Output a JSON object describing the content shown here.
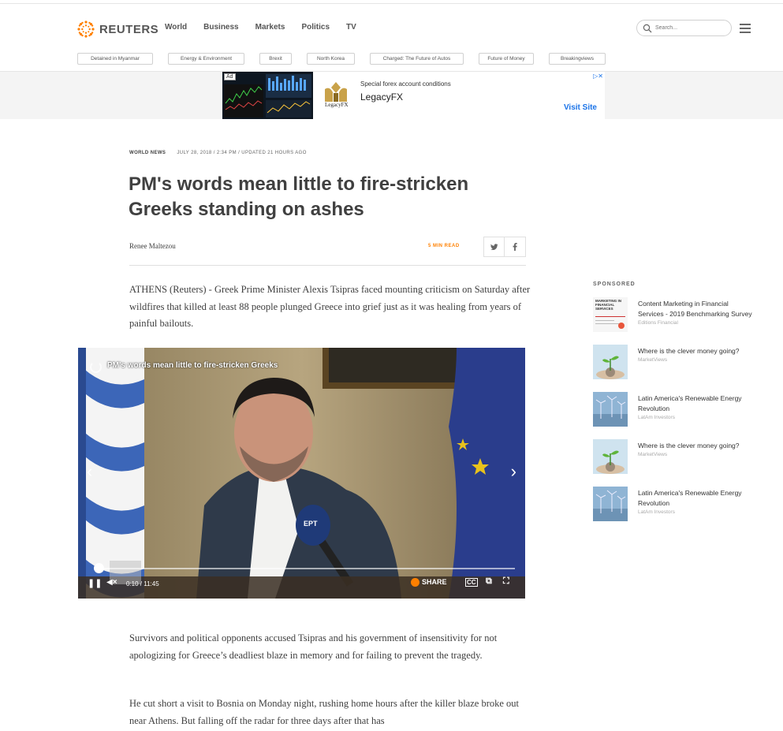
{
  "header": {
    "logo_text": "REUTERS",
    "nav": [
      "World",
      "Business",
      "Markets",
      "Politics",
      "TV"
    ],
    "search_placeholder": "Search...",
    "tags": [
      "Detained in Myanmar",
      "Energy & Environment",
      "Brexit",
      "North Korea",
      "Charged: The Future of Autos",
      "Future of Money",
      "Breakingviews"
    ]
  },
  "ad": {
    "label": "Ad",
    "tagline": "Special forex account conditions",
    "brand": "LegacyFX",
    "logo_text": "LegacyFX",
    "cta": "Visit Site",
    "close": "▷✕"
  },
  "article": {
    "category": "WORLD NEWS",
    "dateline": "JULY 28, 2018 / 2:34 PM / UPDATED 21 HOURS AGO",
    "headline": "PM's words mean little to fire-stricken Greeks standing on ashes",
    "author": "Renee Maltezou",
    "read_time": "5 MIN READ",
    "paragraphs": [
      "ATHENS (Reuters) - Greek Prime Minister Alexis Tsipras faced mounting criticism on Saturday after wildfires that killed at least 88 people plunged Greece into grief just as it was healing from years of painful bailouts.",
      "Survivors and political opponents accused Tsipras and his government of insensitivity for not apologizing for Greece’s deadliest blaze in memory and for failing to prevent the tragedy.",
      "He cut short a visit to Bosnia on Monday night, rushing home hours after the killer blaze broke out near Athens. But falling off the radar for three days after that has"
    ]
  },
  "video": {
    "title": "PM's words mean little to fire-stricken Greeks",
    "time": "0:10 / 11:45",
    "share_label": "SHARE",
    "progress": 0.014,
    "mic_label": "EPT"
  },
  "sidebar": {
    "heading": "SPONSORED",
    "items": [
      {
        "title": "Content Marketing in Financial Services - 2019 Benchmarking Survey",
        "source": "Editions Financial",
        "thumb": "report"
      },
      {
        "title": "Where is the clever money going?",
        "source": "MarketViews",
        "thumb": "plant"
      },
      {
        "title": "Latin America's Renewable Energy Revolution",
        "source": "LatAm Investors",
        "thumb": "wind"
      },
      {
        "title": "Where is the clever money going?",
        "source": "MarketViews",
        "thumb": "plant"
      },
      {
        "title": "Latin America's Renewable Energy Revolution",
        "source": "LatAm Investors",
        "thumb": "wind"
      }
    ],
    "report_thumb_text": "MARKETING IN FINANCIAL SERVICES"
  }
}
